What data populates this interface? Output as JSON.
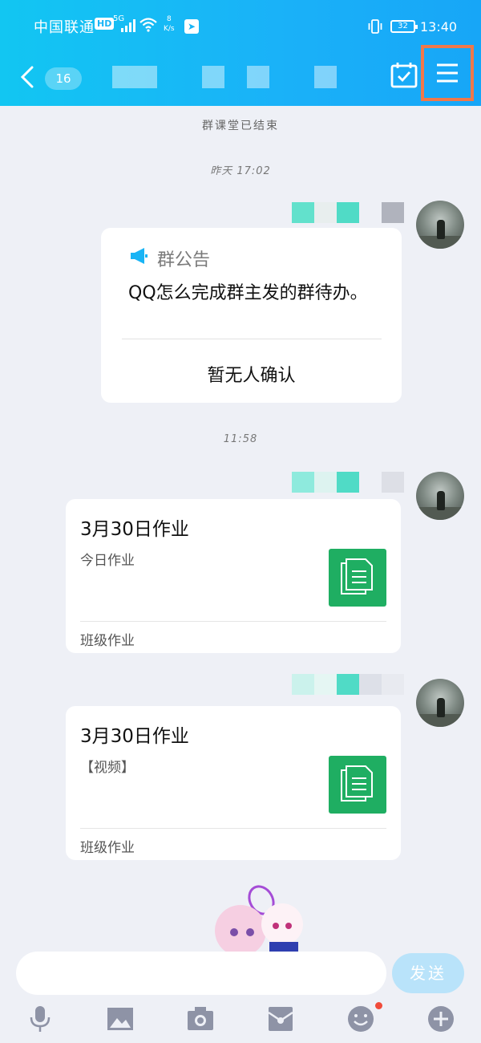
{
  "status_bar": {
    "carrier": "中国联通",
    "hd": "HD",
    "network": "5G",
    "speed_value": "8",
    "speed_unit": "K/s",
    "battery": "32",
    "time": "13:40"
  },
  "navbar": {
    "unread_count": "16",
    "icons": {
      "back": "chevron-left-icon",
      "calendar": "calendar-check-icon",
      "menu": "hamburger-menu-icon"
    }
  },
  "chat": {
    "system_notice": "群课堂已结束",
    "timestamp_1": "昨天 17:02",
    "announcement": {
      "header": "群公告",
      "body": "QQ怎么完成群主发的群待办。",
      "status": "暂无人确认"
    },
    "timestamp_2": "11:58",
    "homework_1": {
      "title": "3月30日作业",
      "subtitle": "今日作业",
      "footer": "班级作业"
    },
    "homework_2": {
      "title": "3月30日作业",
      "subtitle": "【视频】",
      "footer": "班级作业"
    }
  },
  "input": {
    "send_label": "发送"
  },
  "colors": {
    "header_start": "#12C6F2",
    "header_end": "#17A6F7",
    "doc_green": "#1FAE62",
    "highlight_orange": "#F0784A",
    "announcement_icon": "#19B4F5"
  }
}
